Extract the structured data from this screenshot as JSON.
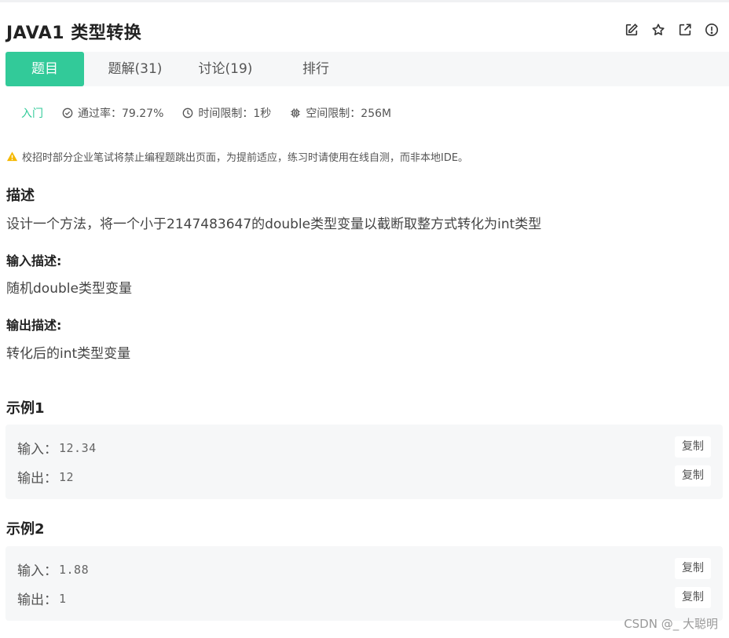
{
  "header": {
    "title": "JAVA1  类型转换",
    "icons": [
      "edit-icon",
      "star-icon",
      "external-link-icon",
      "alert-circle-icon"
    ]
  },
  "tabs": [
    {
      "label": "题目",
      "active": true
    },
    {
      "label": "题解(31)",
      "active": false
    },
    {
      "label": "讨论(19)",
      "active": false
    },
    {
      "label": "排行",
      "active": false
    }
  ],
  "meta": {
    "level": "入门",
    "pass_rate": "通过率：79.27%",
    "time_limit": "时间限制：1秒",
    "space_limit": "空间限制：256M"
  },
  "warning": "校招时部分企业笔试将禁止编程题跳出页面，为提前适应，练习时请使用在线自测，而非本地IDE。",
  "description": {
    "heading": "描述",
    "text": "设计一个方法，将一个小于2147483647的double类型变量以截断取整方式转化为int类型"
  },
  "input_desc": {
    "heading": "输入描述:",
    "text": "随机double类型变量"
  },
  "output_desc": {
    "heading": "输出描述:",
    "text": "转化后的int类型变量"
  },
  "examples": [
    {
      "heading": "示例1",
      "input_label": "输入：",
      "input_value": "12.34",
      "output_label": "输出：",
      "output_value": "12",
      "copy_label": "复制"
    },
    {
      "heading": "示例2",
      "input_label": "输入：",
      "input_value": "1.88",
      "output_label": "输出：",
      "output_value": "1",
      "copy_label": "复制"
    }
  ],
  "watermark": "CSDN @_ 大聪明",
  "colors": {
    "accent": "#32ca99",
    "panel_bg": "#f6f7f8",
    "warning": "#f5b800"
  }
}
